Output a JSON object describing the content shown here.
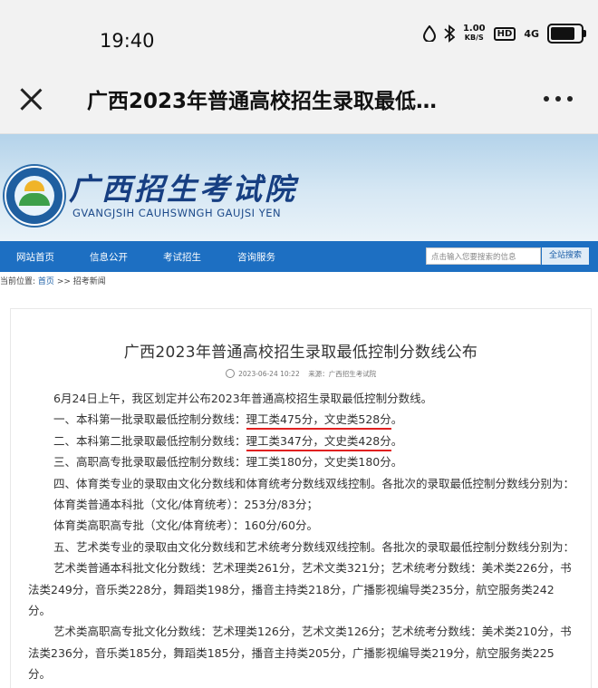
{
  "status_bar": {
    "time": "19:40",
    "net_speed_value": "1.00",
    "net_speed_unit": "KB/S",
    "hd_label": "HD",
    "signal_label": "4G"
  },
  "title_bar": {
    "title": "广西2023年普通高校招生录取最低…"
  },
  "site": {
    "name_cn": "广西招生考试院",
    "name_pinyin": "GVANGJSIH CAUHSWNGH GAUJSI YEN"
  },
  "nav": {
    "items": [
      "网站首页",
      "信息公开",
      "考试招生",
      "咨询服务"
    ],
    "search_placeholder": "点击输入您要搜索的信息",
    "search_button": "全站搜索"
  },
  "breadcrumb": {
    "label": "当前位置:",
    "home": "首页",
    "rest": ">> 招考新闻"
  },
  "article": {
    "title": "广西2023年普通高校招生录取最低控制分数线公布",
    "date": "2023-06-24 10:22",
    "source": "来源：广西招生考试院",
    "intro": "6月24日上午，我区划定并公布2023年普通高校招生录取最低控制分数线。",
    "line1_prefix": "一、本科第一批录取最低控制分数线：",
    "line1_score": "理工类475分，文史类528分",
    "line1_suffix": "。",
    "line2_prefix": "二、本科第二批录取最低控制分数线：",
    "line2_score": "理工类347分，文史类428分",
    "line2_suffix": "。",
    "line3": "三、高职高专批录取最低控制分数线：理工类180分，文史类180分。",
    "line4": "四、体育类专业的录取由文化分数线和体育统考分数线双线控制。各批次的录取最低控制分数线分别为：",
    "sports1": "体育类普通本科批（文化/体育统考）：253分/83分；",
    "sports2": "体育类高职高专批（文化/体育统考）：160分/60分。",
    "line5": "五、艺术类专业的录取由文化分数线和艺术统考分数线双线控制。各批次的录取最低控制分数线分别为：",
    "art1": "艺术类普通本科批文化分数线：艺术理类261分，艺术文类321分；艺术统考分数线：美术类226分，书法类249分，音乐类228分，舞蹈类198分，播音主持类218分，广播影视编导类235分，航空服务类242分。",
    "art2": "艺术类高职高专批文化分数线：艺术理类126分，艺术文类126分；艺术统考分数线：美术类210分，书法类236分，音乐类185分，舞蹈类185分，播音主持类205分，广播影视编导类219分，航空服务类225分。"
  },
  "colors": {
    "nav_bar": "#1d6fc2",
    "underline": "#e02020",
    "site_name": "#173f82"
  }
}
